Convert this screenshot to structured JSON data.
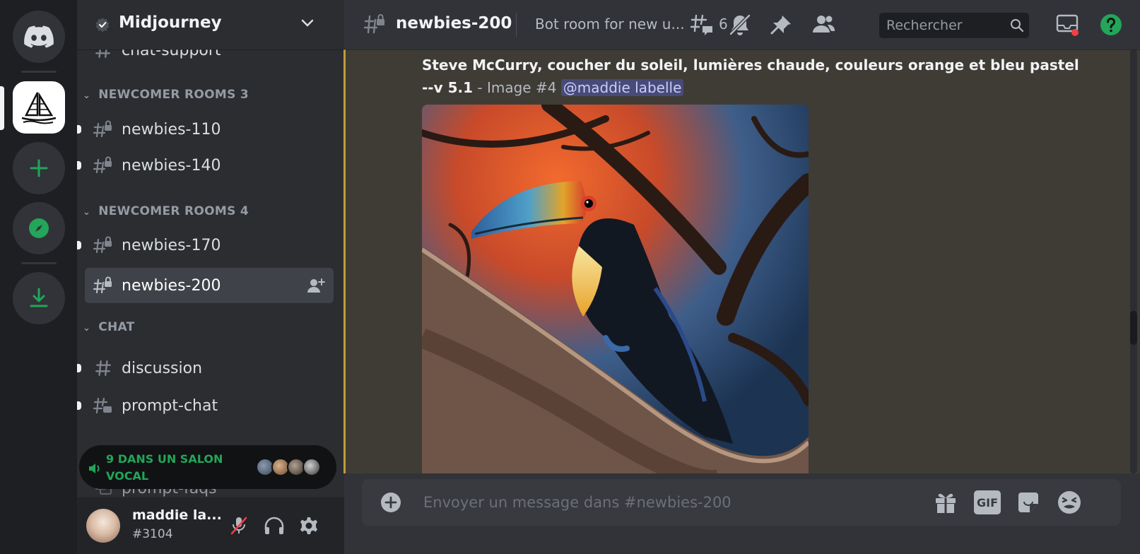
{
  "server": {
    "name": "Midjourney"
  },
  "sidebar": {
    "partial_channel": "chat-support",
    "categories": [
      {
        "label": "NEWCOMER ROOMS 3",
        "channels": [
          "newbies-110",
          "newbies-140"
        ]
      },
      {
        "label": "NEWCOMER ROOMS 4",
        "channels": [
          "newbies-170",
          "newbies-200"
        ]
      },
      {
        "label": "CHAT",
        "channels": [
          "discussion",
          "prompt-chat"
        ]
      }
    ],
    "partial_bottom_channel": "prompt-faqs",
    "voice_banner": "9 DANS UN SALON VOCAL"
  },
  "user": {
    "name": "maddie la...",
    "tag": "#3104"
  },
  "header": {
    "channel_name": "newbies-200",
    "topic": "Bot room for new u...",
    "threads_count": "6",
    "search_placeholder": "Rechercher"
  },
  "message": {
    "prompt": "Steve McCurry, coucher du soleil, lumières chaude, couleurs orange et bleu pastel",
    "params": "--v 5.1",
    "image_label": " - Image #4 ",
    "mention": "@maddie labelle"
  },
  "composer": {
    "placeholder": "Envoyer un message dans #newbies-200",
    "gif_label": "GIF"
  },
  "colors": {
    "green": "#23a55a",
    "help": "#23a55a",
    "red_dot": "#f23f43",
    "mention_bg": "#5865f2"
  }
}
